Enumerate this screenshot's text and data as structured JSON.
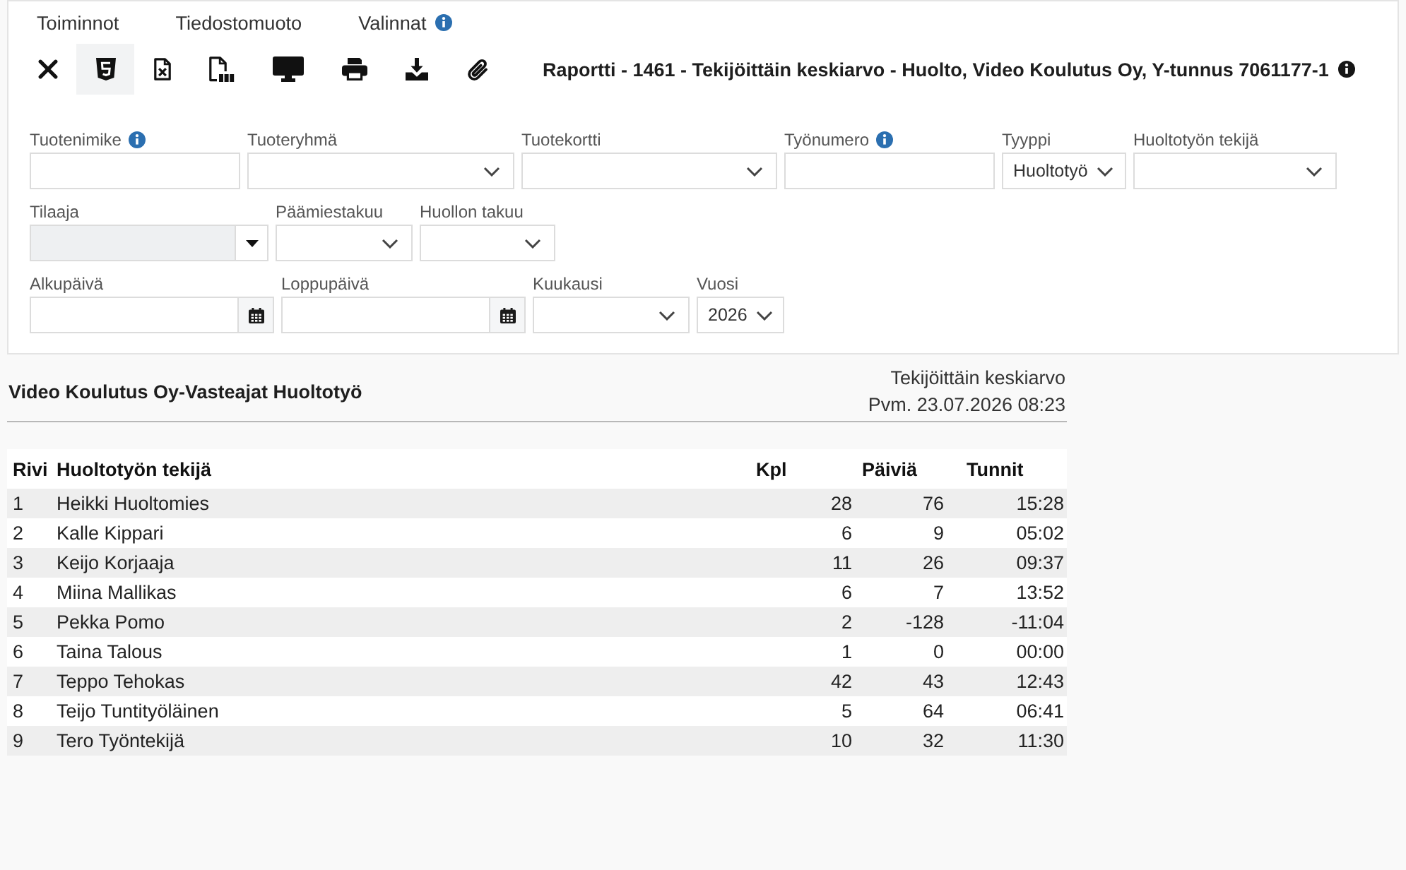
{
  "menu": [
    {
      "label": "Toiminnot",
      "info": false
    },
    {
      "label": "Tiedostomuoto",
      "info": false
    },
    {
      "label": "Valinnat",
      "info": true
    }
  ],
  "toolbar": {
    "buttons": [
      {
        "kind": "close",
        "selected": false
      },
      {
        "kind": "html",
        "selected": true
      },
      {
        "kind": "excel",
        "selected": false
      },
      {
        "kind": "pdf",
        "selected": false
      },
      {
        "kind": "screen",
        "selected": false
      },
      {
        "kind": "print",
        "selected": false
      },
      {
        "kind": "download",
        "selected": false
      },
      {
        "kind": "attach",
        "selected": false
      }
    ],
    "title": "Raportti - 1461 - Tekijöittäin keskiarvo - Huolto, Video Koulutus Oy, Y-tunnus 7061177-1",
    "info": true
  },
  "filter_rows": [
    {
      "fields": [
        {
          "label": "Tuotenimike",
          "info": true,
          "kind": "text",
          "disabled": false
        },
        {
          "label": "Tuoteryhmä",
          "info": false,
          "kind": "select",
          "disabled": false
        },
        {
          "label": "Tuotekortti",
          "info": false,
          "kind": "select",
          "disabled": false
        },
        {
          "label": "Työnumero",
          "info": true,
          "kind": "text",
          "disabled": false
        },
        {
          "label": "Tyyppi",
          "info": false,
          "kind": "select",
          "value": "Huoltotyö",
          "disabled": false
        },
        {
          "label": "Huoltotyön tekijä",
          "info": false,
          "kind": "select",
          "disabled": false
        }
      ]
    },
    {
      "fields": [
        {
          "label": "Tilaaja",
          "info": false,
          "kind": "combo",
          "disabled": true
        },
        {
          "label": "Päämiestakuu",
          "info": false,
          "kind": "select",
          "disabled": false
        },
        {
          "label": "Huollon takuu",
          "info": false,
          "kind": "select",
          "disabled": false
        }
      ]
    },
    {
      "fields": [
        {
          "label": "Alkupäivä",
          "info": false,
          "kind": "date",
          "disabled": false
        },
        {
          "label": "Loppupäivä",
          "info": false,
          "kind": "date",
          "disabled": false
        },
        {
          "label": "Kuukausi",
          "info": false,
          "kind": "select",
          "disabled": false
        },
        {
          "label": "Vuosi",
          "info": false,
          "kind": "select",
          "value": "2026",
          "disabled": false
        }
      ]
    }
  ],
  "report": {
    "title": "Video Koulutus Oy-Vasteajat Huoltotyö",
    "subtitle": "Tekijöittäin keskiarvo",
    "date": "Pvm. 23.07.2026 08:23"
  },
  "table": {
    "columns": [
      "Rivi",
      "Huoltotyön tekijä",
      "Kpl",
      "Päiviä",
      "Tunnit"
    ],
    "rows": [
      [
        "1",
        "Heikki Huoltomies",
        "28",
        "76",
        "15:28"
      ],
      [
        "2",
        "Kalle Kippari",
        "6",
        "9",
        "05:02"
      ],
      [
        "3",
        "Keijo Korjaaja",
        "11",
        "26",
        "09:37"
      ],
      [
        "4",
        "Miina Mallikas",
        "6",
        "7",
        "13:52"
      ],
      [
        "5",
        "Pekka Pomo",
        "2",
        "-128",
        "-11:04"
      ],
      [
        "6",
        "Taina Talous",
        "1",
        "0",
        "00:00"
      ],
      [
        "7",
        "Teppo Tehokas",
        "42",
        "43",
        "12:43"
      ],
      [
        "8",
        "Teijo Tuntityöläinen",
        "5",
        "64",
        "06:41"
      ],
      [
        "9",
        "Tero Työntekijä",
        "10",
        "32",
        "11:30"
      ]
    ]
  }
}
